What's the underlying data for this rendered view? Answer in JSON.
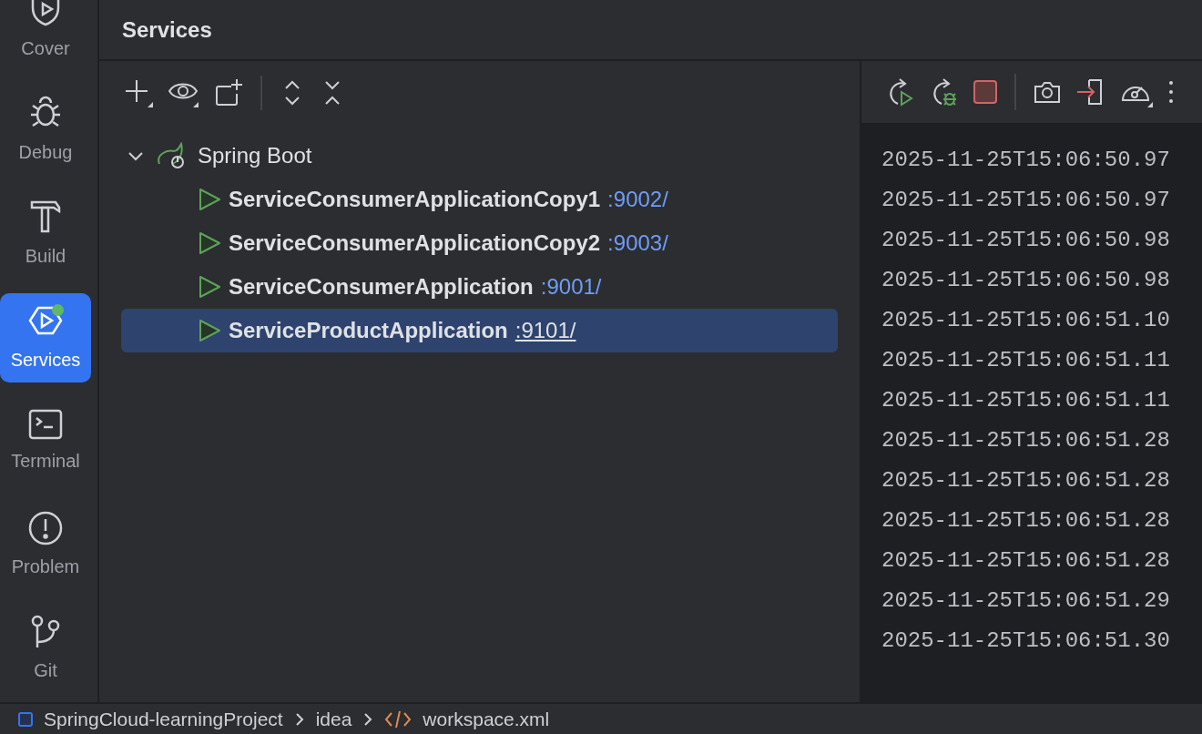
{
  "sidebar": {
    "items": [
      {
        "label": "Cover",
        "selected": false,
        "status_dot": false
      },
      {
        "label": "Debug",
        "selected": false,
        "status_dot": false
      },
      {
        "label": "Build",
        "selected": false,
        "status_dot": false
      },
      {
        "label": "Services",
        "selected": true,
        "status_dot": true
      },
      {
        "label": "Terminal",
        "selected": false,
        "status_dot": false
      },
      {
        "label": "Problem",
        "selected": false,
        "status_dot": false
      },
      {
        "label": "Git",
        "selected": false,
        "status_dot": false
      }
    ]
  },
  "panel": {
    "title": "Services"
  },
  "tree": [
    {
      "label": "Spring Boot",
      "expanded": true,
      "children": [
        {
          "name": "ServiceConsumerApplicationCopy1",
          "port": ":9002/",
          "selected": false
        },
        {
          "name": "ServiceConsumerApplicationCopy2",
          "port": ":9003/",
          "selected": false
        },
        {
          "name": "ServiceConsumerApplication",
          "port": ":9001/",
          "selected": false
        },
        {
          "name": "ServiceProductApplication",
          "port": ":9101/",
          "selected": true
        }
      ]
    }
  ],
  "console": {
    "lines": [
      "2025-11-25T15:06:50.97",
      "2025-11-25T15:06:50.97",
      "2025-11-25T15:06:50.98",
      "2025-11-25T15:06:50.98",
      "2025-11-25T15:06:51.10",
      "2025-11-25T15:06:51.11",
      "2025-11-25T15:06:51.11",
      "2025-11-25T15:06:51.28",
      "2025-11-25T15:06:51.28",
      "2025-11-25T15:06:51.28",
      "2025-11-25T15:06:51.28",
      "2025-11-25T15:06:51.29",
      "2025-11-25T15:06:51.30"
    ]
  },
  "breadcrumbs": [
    "SpringCloud-learningProject",
    "idea",
    "workspace.xml"
  ]
}
